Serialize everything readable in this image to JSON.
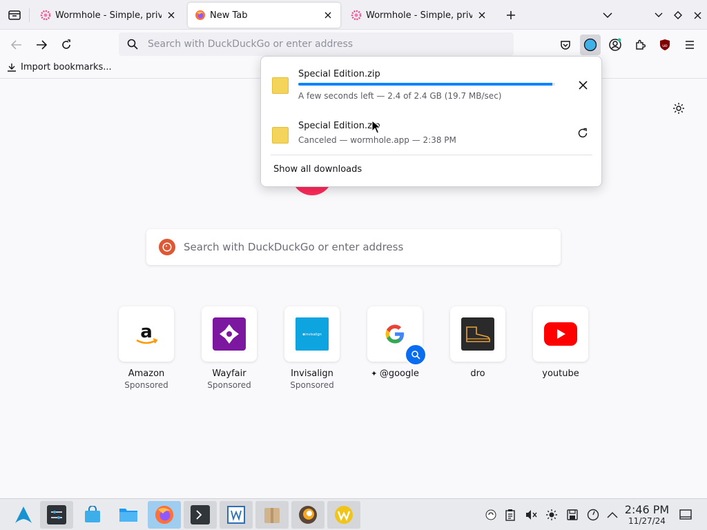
{
  "tabs": [
    {
      "title": "Wormhole - Simple, privat",
      "active": false,
      "favicon": "wormhole-icon"
    },
    {
      "title": "New Tab",
      "active": true,
      "favicon": "firefox-icon"
    },
    {
      "title": "Wormhole - Simple, privat",
      "active": false,
      "favicon": "wormhole-icon"
    }
  ],
  "urlbar": {
    "placeholder": "Search with DuckDuckGo or enter address"
  },
  "bookmarks": {
    "import_label": "Import bookmarks..."
  },
  "newtab": {
    "search_placeholder": "Search with DuckDuckGo or enter address",
    "tiles": [
      {
        "name": "Amazon",
        "sponsor": "Sponsored"
      },
      {
        "name": "Wayfair",
        "sponsor": "Sponsored"
      },
      {
        "name": "Invisalign",
        "sponsor": "Sponsored",
        "card_text": "invisalign"
      },
      {
        "name": "@google",
        "sponsor": ""
      },
      {
        "name": "dro",
        "sponsor": ""
      },
      {
        "name": "youtube",
        "sponsor": ""
      }
    ]
  },
  "downloads": {
    "items": [
      {
        "filename": "Special Edition.zip",
        "status": "A few seconds left — 2.4 of 2.4 GB (19.7 MB/sec)",
        "progress": 0.99,
        "action": "cancel"
      },
      {
        "filename": "Special Edition.zip",
        "status": "Canceled — wormhole.app — 2:38 PM",
        "action": "retry"
      }
    ],
    "show_all_label": "Show all downloads"
  },
  "taskbar": {
    "time": "2:46 PM",
    "date": "11/27/24"
  },
  "colors": {
    "accent": "#0a84ff",
    "youtube_red": "#ff0000",
    "wayfair_purple": "#7b189f",
    "invisalign_blue": "#0da4e0",
    "google_badge": "#0a6cf0"
  }
}
